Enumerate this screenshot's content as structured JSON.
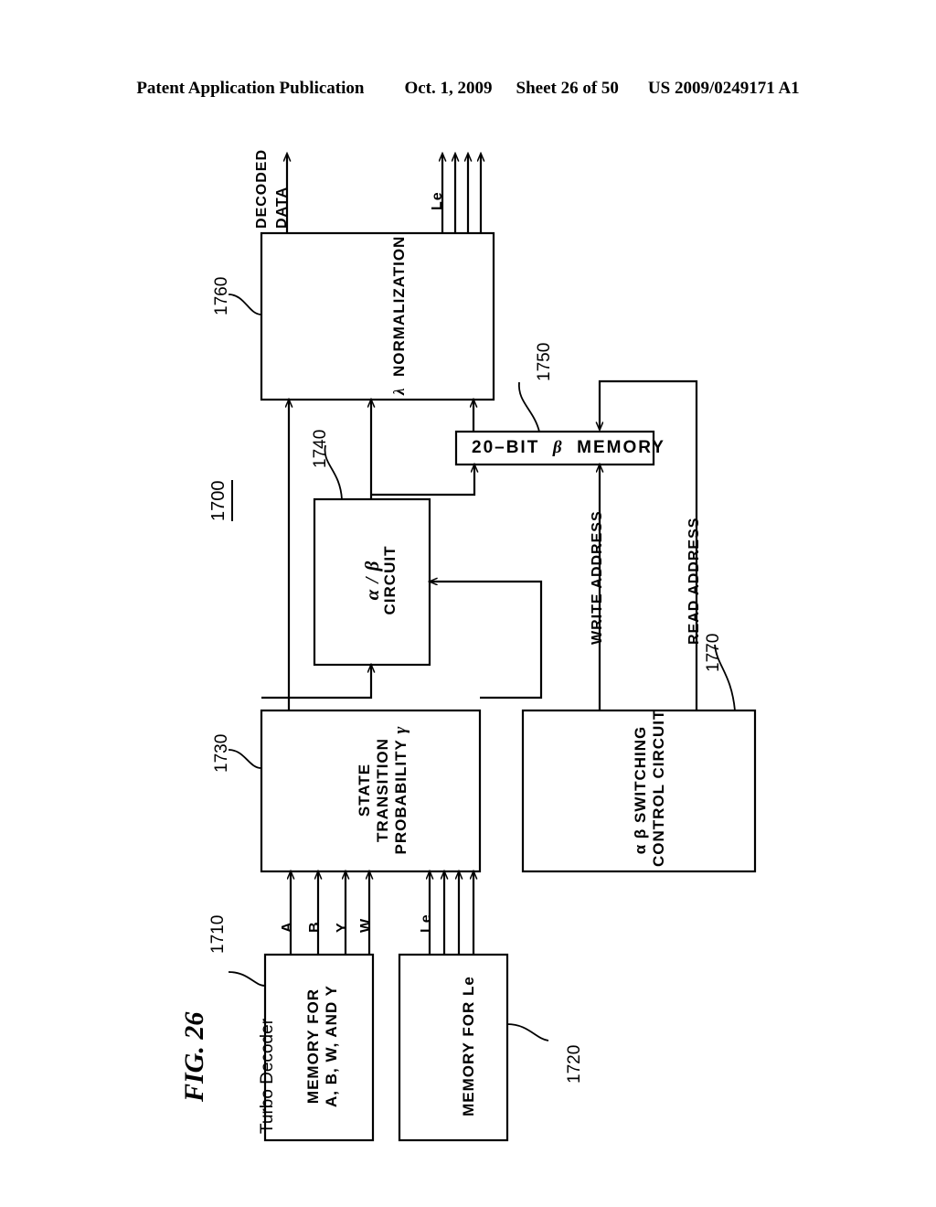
{
  "header": {
    "publication": "Patent Application Publication",
    "date": "Oct. 1, 2009",
    "sheet": "Sheet 26 of 50",
    "docnum": "US 2009/0249171 A1"
  },
  "figure": {
    "label": "FIG. 26",
    "system_title": "Turbo Decoder",
    "system_ref": "1700"
  },
  "blocks": {
    "memory_abwy": {
      "line1": "MEMORY FOR",
      "line2": "A, B, W, AND Y",
      "ref": "1710"
    },
    "memory_le": {
      "line1": "MEMORY FOR Le",
      "ref": "1720"
    },
    "gamma": {
      "line1": "STATE",
      "line2": "TRANSITION",
      "line3": "PROBABILITY",
      "symbol": "γ",
      "ref": "1730"
    },
    "alpha_beta": {
      "line1": "α / β",
      "line2": "CIRCUIT",
      "ref": "1740"
    },
    "beta_memory": {
      "pre": "20–BIT",
      "symbol": "β",
      "post": "MEMORY",
      "ref": "1750"
    },
    "lambda_norm": {
      "symbol": "λ",
      "text": "NORMALIZATION",
      "ref": "1760"
    },
    "switch_ctrl": {
      "line1": "α β SWITCHING",
      "line2": "CONTROL CIRCUIT",
      "ref": "1770"
    }
  },
  "signals": {
    "decoded_data_l1": "DECODED",
    "decoded_data_l2": "DATA",
    "le_out": "Le",
    "le_in": "Le",
    "a": "A",
    "b": "B",
    "y": "Y",
    "w": "W",
    "write_address": "WRITE ADDRESS",
    "read_address": "READ ADDRESS"
  },
  "style": {
    "ink": "#000000",
    "paper": "#ffffff"
  }
}
